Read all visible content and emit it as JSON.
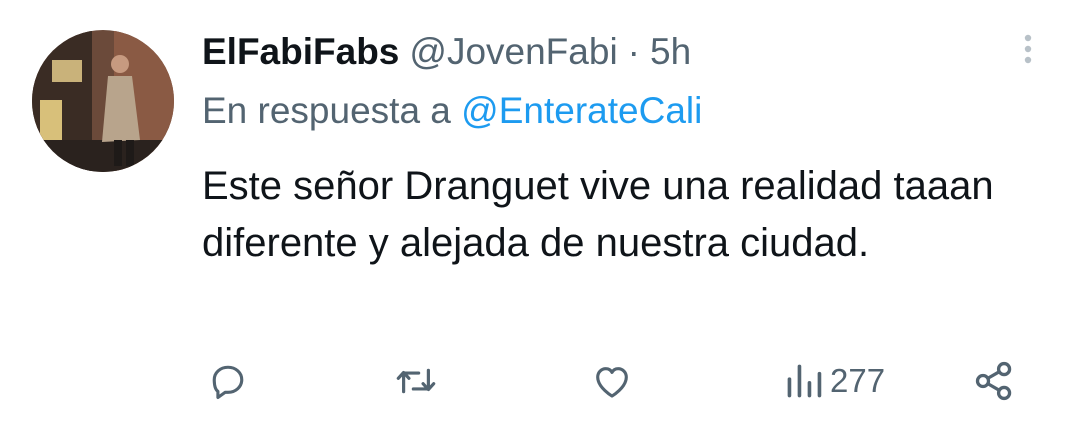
{
  "tweet": {
    "display_name": "ElFabiFabs",
    "handle": "@JovenFabi",
    "separator": "·",
    "time": "5h",
    "reply_prefix": "En respuesta a",
    "reply_to": "@EnterateCali",
    "text": "Este señor Dranguet vive una realidad taaan diferente y alejada de nuestra ciudad."
  },
  "actions": {
    "views": "277",
    "icons": [
      "reply-icon",
      "retweet-icon",
      "like-icon",
      "views-icon",
      "share-icon"
    ]
  },
  "colors": {
    "text": "#0f1419",
    "secondary": "#536471",
    "link": "#1d9bf0"
  }
}
